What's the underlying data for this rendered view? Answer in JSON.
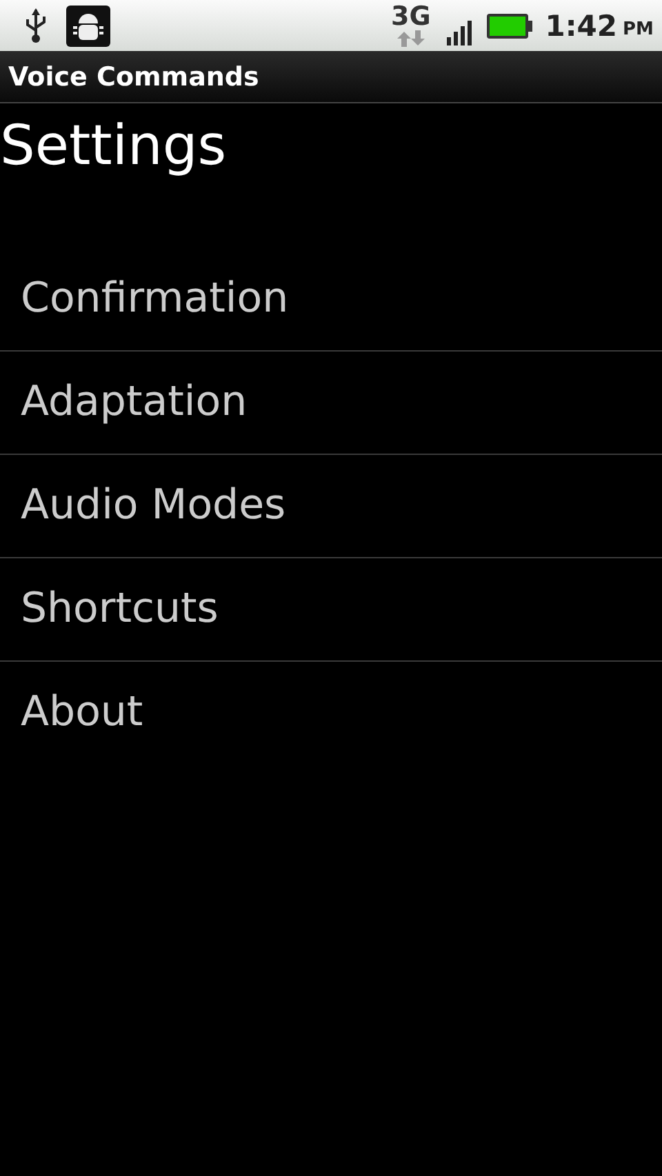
{
  "status_bar": {
    "network": "3G",
    "time": "1:42",
    "ampm": "PM"
  },
  "title_bar": {
    "title": "Voice Commands"
  },
  "heading": "Settings",
  "items": [
    {
      "label": "Confirmation"
    },
    {
      "label": "Adaptation"
    },
    {
      "label": "Audio Modes"
    },
    {
      "label": "Shortcuts"
    },
    {
      "label": "About"
    }
  ]
}
